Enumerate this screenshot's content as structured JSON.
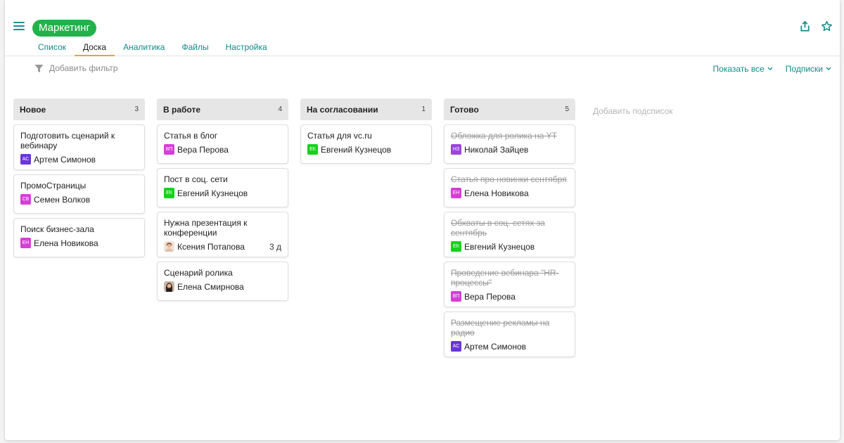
{
  "project": {
    "title": "Маркетинг"
  },
  "tabs": [
    "Список",
    "Доска",
    "Аналитика",
    "Файлы",
    "Настройка"
  ],
  "active_tab": "Доска",
  "filter": {
    "add_label": "Добавить фильтр"
  },
  "controls": {
    "show_all": "Показать все",
    "sublists": "Подписки"
  },
  "add_sublist": "Добавить подсписок",
  "colors": {
    "accent": "#108a8a",
    "brand": "#22b24c",
    "tab_underline": "#e0a63a"
  },
  "columns": [
    {
      "title": "Новое",
      "count": "3",
      "cards": [
        {
          "title": "Подготовить сценарий к вебинару",
          "initials": "АС",
          "color": "#6a35d9",
          "assignee": "Артем Симонов"
        },
        {
          "title": "ПромоСтраницы",
          "initials": "СВ",
          "color": "#d63ed6",
          "assignee": "Семен Волков"
        },
        {
          "title": "Поиск бизнес-зала",
          "initials": "ЕН",
          "color": "#d63ed6",
          "assignee": "Елена Новикова"
        }
      ]
    },
    {
      "title": "В работе",
      "count": "4",
      "cards": [
        {
          "title": "Статья в блог",
          "initials": "ВП",
          "color": "#d63ed6",
          "assignee": "Вера Перова"
        },
        {
          "title": "Пост в соц. сети",
          "initials": "ЕК",
          "color": "#19d01f",
          "assignee": "Евгений Кузнецов"
        },
        {
          "title": "Нужна презентация к конференции",
          "photo": "woman-light",
          "assignee": "Ксения Потапова",
          "due": "3 д"
        },
        {
          "title": "Сценарий ролика",
          "photo": "woman-dark",
          "assignee": "Елена Смирнова"
        }
      ]
    },
    {
      "title": "На согласовании",
      "count": "1",
      "cards": [
        {
          "title": "Статья для vc.ru",
          "initials": "ЕК",
          "color": "#19d01f",
          "assignee": "Евгений Кузнецов"
        }
      ]
    },
    {
      "title": "Готово",
      "count": "5",
      "cards": [
        {
          "title": "Обложка для ролика на YT",
          "done": true,
          "initials": "НЗ",
          "color": "#9b45d9",
          "assignee": "Николай Зайцев"
        },
        {
          "title": "Статья про новинки сентября",
          "done": true,
          "initials": "ЕН",
          "color": "#d63ed6",
          "assignee": "Елена Новикова"
        },
        {
          "title": "Обхваты в соц. сетях за сентябрь",
          "done": true,
          "initials": "ЕК",
          "color": "#19d01f",
          "assignee": "Евгений Кузнецов"
        },
        {
          "title": "Проведение вебинара \"HR-процессы\"",
          "done": true,
          "initials": "ВП",
          "color": "#d63ed6",
          "assignee": "Вера Перова"
        },
        {
          "title": "Размещение рекламы на радио",
          "done": true,
          "initials": "АС",
          "color": "#6a35d9",
          "assignee": "Артем Симонов"
        }
      ]
    }
  ]
}
